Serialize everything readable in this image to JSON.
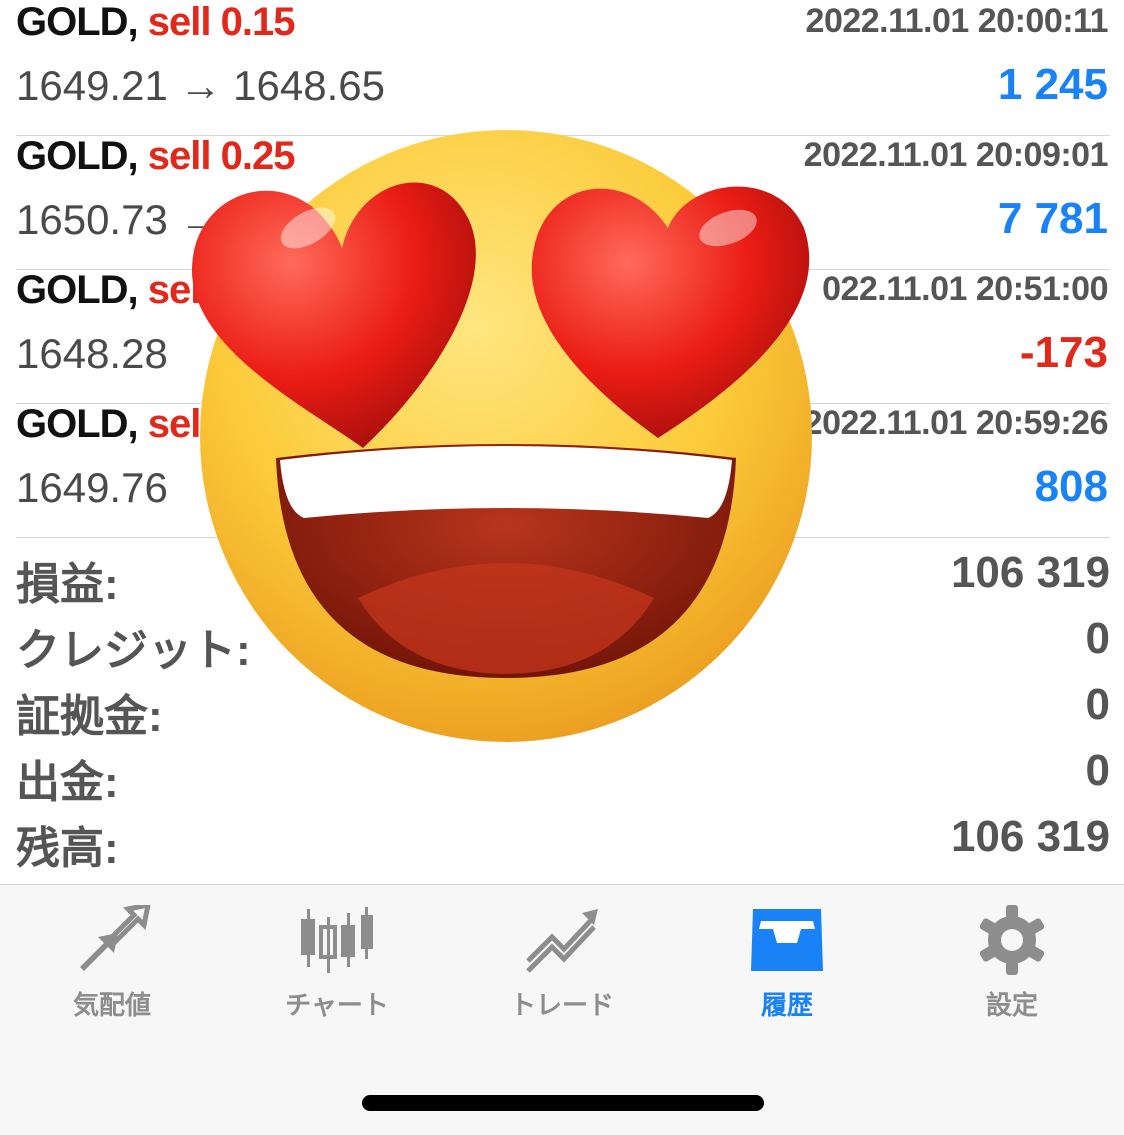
{
  "trades": [
    {
      "symbol": "GOLD,",
      "side": "sell 0.15",
      "time": "2022.11.01 20:00:11",
      "prices": "1649.21 → 1648.65",
      "profit": "1 245",
      "profit_sign": "pos"
    },
    {
      "symbol": "GOLD,",
      "side": "sell 0.25",
      "time": "2022.11.01 20:09:01",
      "prices": "1650.73 → 1",
      "profit": "7 781",
      "profit_sign": "pos"
    },
    {
      "symbol": "GOLD,",
      "side": "sel",
      "time": "022.11.01 20:51:00",
      "prices": "1648.28",
      "profit": "-173",
      "profit_sign": "neg"
    },
    {
      "symbol": "GOLD,",
      "side": "sel",
      "time": "2022.11.01 20:59:26",
      "prices": "1649.76",
      "profit": "808",
      "profit_sign": "pos"
    }
  ],
  "summary": [
    {
      "label": "損益:",
      "value": "106 319"
    },
    {
      "label": "クレジット:",
      "value": "0"
    },
    {
      "label": "証拠金:",
      "value": "0"
    },
    {
      "label": "出金:",
      "value": "0"
    },
    {
      "label": "残高:",
      "value": "106 319"
    }
  ],
  "tabs": [
    {
      "label": "気配値",
      "icon": "quotes-arrows-icon"
    },
    {
      "label": "チャート",
      "icon": "candlestick-chart-icon"
    },
    {
      "label": "トレード",
      "icon": "trade-trend-icon"
    },
    {
      "label": "履歴",
      "icon": "history-tray-icon",
      "active": true
    },
    {
      "label": "設定",
      "icon": "gear-icon"
    }
  ],
  "overlay": {
    "icon": "smiling-face-with-heart-eyes-emoji"
  },
  "colors": {
    "profit_positive": "#1a82f7",
    "profit_negative": "#e0281b",
    "tab_active": "#1a82f7",
    "tab_inactive": "#8d8d8d"
  }
}
